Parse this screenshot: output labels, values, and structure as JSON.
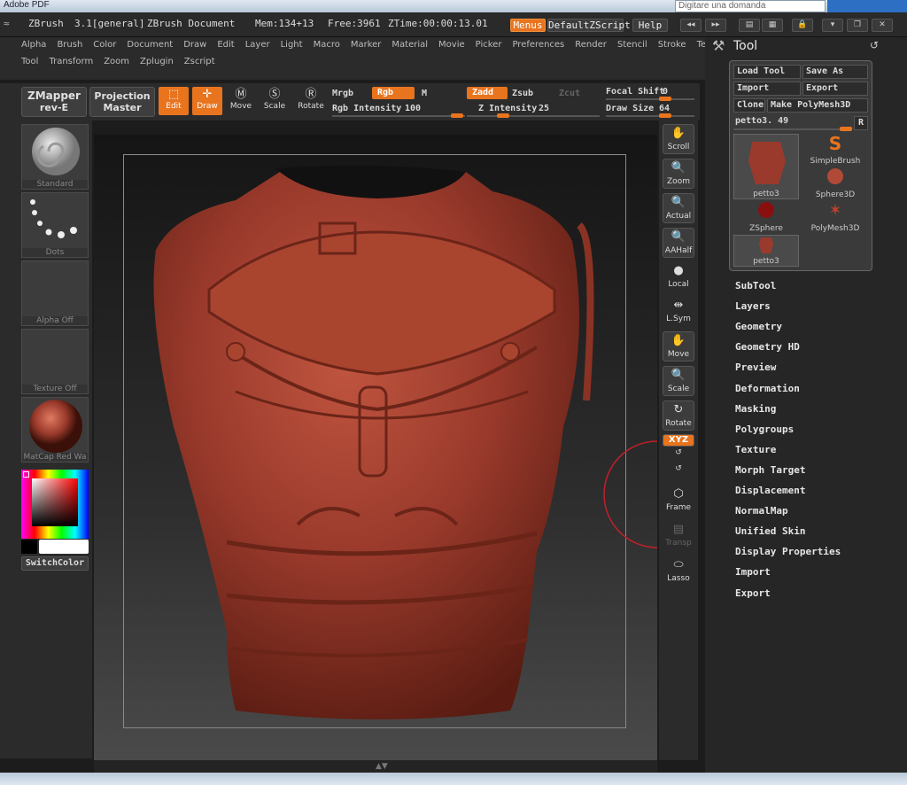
{
  "os": {
    "window_title": "Adobe PDF",
    "search_placeholder": "Digitare una domanda"
  },
  "titlebar": {
    "app": "ZBrush",
    "version": "3.1[general]",
    "document": "ZBrush Document",
    "mem": "Mem:134+13",
    "free": "Free:3961",
    "ztime": "ZTime:00:00:13.01",
    "menus_btn": "Menus",
    "script_btn": "DefaultZScript",
    "help_btn": "Help"
  },
  "menus": {
    "row1": [
      "Alpha",
      "Brush",
      "Color",
      "Document",
      "Draw",
      "Edit",
      "Layer",
      "Light",
      "Macro",
      "Marker",
      "Material",
      "Movie",
      "Picker",
      "Preferences",
      "Render",
      "Stencil",
      "Stroke",
      "Texture"
    ],
    "row2": [
      "Tool",
      "Transform",
      "Zoom",
      "Zplugin",
      "Zscript"
    ]
  },
  "toolbar": {
    "zmapper_line1": "ZMapper",
    "zmapper_line2": "rev-E",
    "projection_line1": "Projection",
    "projection_line2": "Master",
    "edit": "Edit",
    "draw": "Draw",
    "move": "Move",
    "scale": "Scale",
    "rotate": "Rotate",
    "mrgb": "Mrgb",
    "rgb": "Rgb",
    "m": "M",
    "rgb_intensity_label": "Rgb Intensity",
    "rgb_intensity_value": "100",
    "zadd": "Zadd",
    "zsub": "Zsub",
    "zcut": "Zcut",
    "z_intensity_label": "Z Intensity",
    "z_intensity_value": "25",
    "focal_shift_label": "Focal Shift",
    "focal_shift_value": "0",
    "draw_size_label": "Draw Size",
    "draw_size_value": "64"
  },
  "left_shelf": {
    "brush": "Standard",
    "stroke": "Dots",
    "alpha": "Alpha Off",
    "texture": "Texture Off",
    "material": "MatCap Red Wa",
    "switch_color": "SwitchColor"
  },
  "right_col": {
    "scroll": "Scroll",
    "zoom": "Zoom",
    "actual": "Actual",
    "aahalf": "AAHalf",
    "local": "Local",
    "lsym": "L.Sym",
    "move": "Move",
    "scale": "Scale",
    "rotate": "Rotate",
    "xyz": "XYZ",
    "frame": "Frame",
    "transp": "Transp",
    "lasso": "Lasso"
  },
  "tool_panel": {
    "title": "Tool",
    "load_tool": "Load Tool",
    "save_as": "Save As",
    "import": "Import",
    "export": "Export",
    "clone": "Clone",
    "make_polymesh": "Make PolyMesh3D",
    "current_tool": "petto3. 49",
    "r_btn": "R",
    "thumbs": [
      {
        "name": "petto3"
      },
      {
        "name": "SimpleBrush"
      },
      {
        "name": "Sphere3D"
      },
      {
        "name": "ZSphere"
      },
      {
        "name": "PolyMesh3D"
      },
      {
        "name": "petto3"
      }
    ],
    "sections": [
      "SubTool",
      "Layers",
      "Geometry",
      "Geometry HD",
      "Preview",
      "Deformation",
      "Masking",
      "Polygroups",
      "Texture",
      "Morph Target",
      "Displacement",
      "NormalMap",
      "Unified Skin",
      "Display Properties",
      "Import",
      "Export"
    ]
  },
  "colors": {
    "accent": "#e8741e",
    "panel": "#2b2b2b",
    "model": "#9a3a2c"
  }
}
